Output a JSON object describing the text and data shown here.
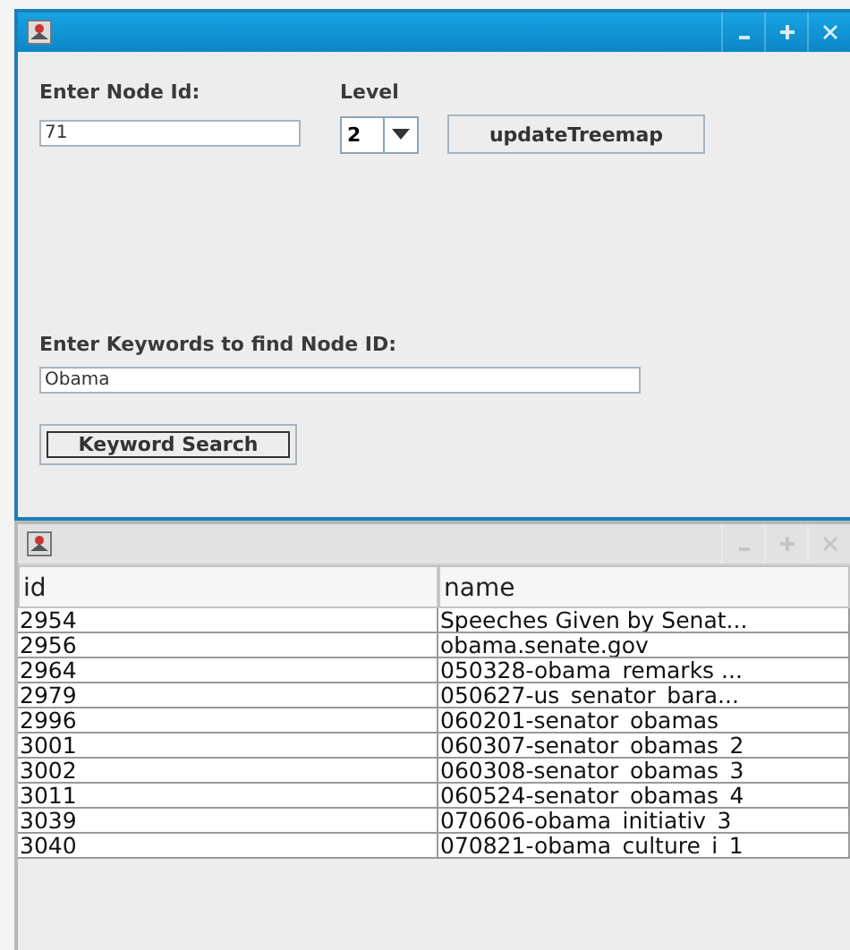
{
  "main_window": {
    "active": true,
    "node_id": {
      "label": "Enter Node Id:",
      "value": "71"
    },
    "level": {
      "label": "Level",
      "value": "2"
    },
    "update_button": "updateTreemap",
    "keywords": {
      "label": "Enter Keywords to find Node ID:",
      "value": "Obama"
    },
    "search_button": "Keyword Search"
  },
  "results_window": {
    "active": false,
    "table": {
      "columns": [
        "id",
        "name"
      ],
      "rows": [
        [
          "2954",
          "Speeches Given by Senat..."
        ],
        [
          "2956",
          "obama.senate.gov"
        ],
        [
          "2964",
          "050328-obama_remarks ..."
        ],
        [
          "2979",
          "050627-us_senator_bara..."
        ],
        [
          "2996",
          "060201-senator_obamas_"
        ],
        [
          "3001",
          "060307-senator_obamas_2"
        ],
        [
          "3002",
          "060308-senator_obamas_3"
        ],
        [
          "3011",
          "060524-senator_obamas_4"
        ],
        [
          "3039",
          "070606-obama_initiativ_3"
        ],
        [
          "3040",
          "070821-obama_culture_i_1"
        ]
      ]
    }
  }
}
